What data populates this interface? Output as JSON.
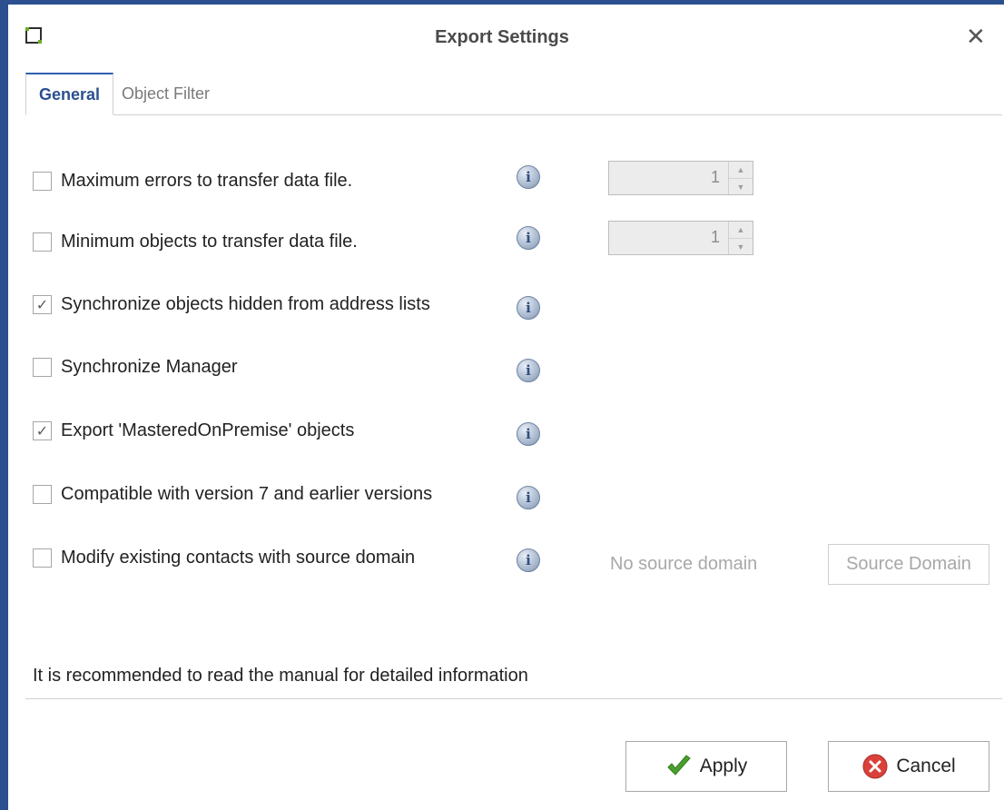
{
  "window": {
    "title": "Export Settings",
    "close_glyph": "✕",
    "app_icon": "app-frame-icon"
  },
  "tabs": [
    {
      "label": "General",
      "active": true
    },
    {
      "label": "Object Filter",
      "active": false
    }
  ],
  "options": [
    {
      "label": "Maximum errors to transfer data file.",
      "checked": false,
      "spin_value": "1"
    },
    {
      "label": "Minimum objects to transfer data file.",
      "checked": false,
      "spin_value": "1"
    },
    {
      "label": "Synchronize objects hidden from address lists",
      "checked": true
    },
    {
      "label": "Synchronize Manager",
      "checked": false
    },
    {
      "label": "Export 'MasteredOnPremise' objects",
      "checked": true
    },
    {
      "label": "Compatible with version 7 and earlier versions",
      "checked": false
    },
    {
      "label": "Modify existing contacts with source domain",
      "checked": false
    }
  ],
  "info_glyph": "i",
  "source_domain": {
    "status_text": "No source domain",
    "button_label": "Source Domain"
  },
  "footer": {
    "manual_note": "It is recommended to read the manual for detailed information",
    "apply_label": "Apply",
    "cancel_label": "Cancel"
  },
  "colors": {
    "window_border": "#2b4f8f",
    "active_tab_text": "#2b4f8f",
    "apply_check": "#4aa02c",
    "cancel_circle": "#d9413a",
    "app_icon_green": "#6cae2a"
  }
}
